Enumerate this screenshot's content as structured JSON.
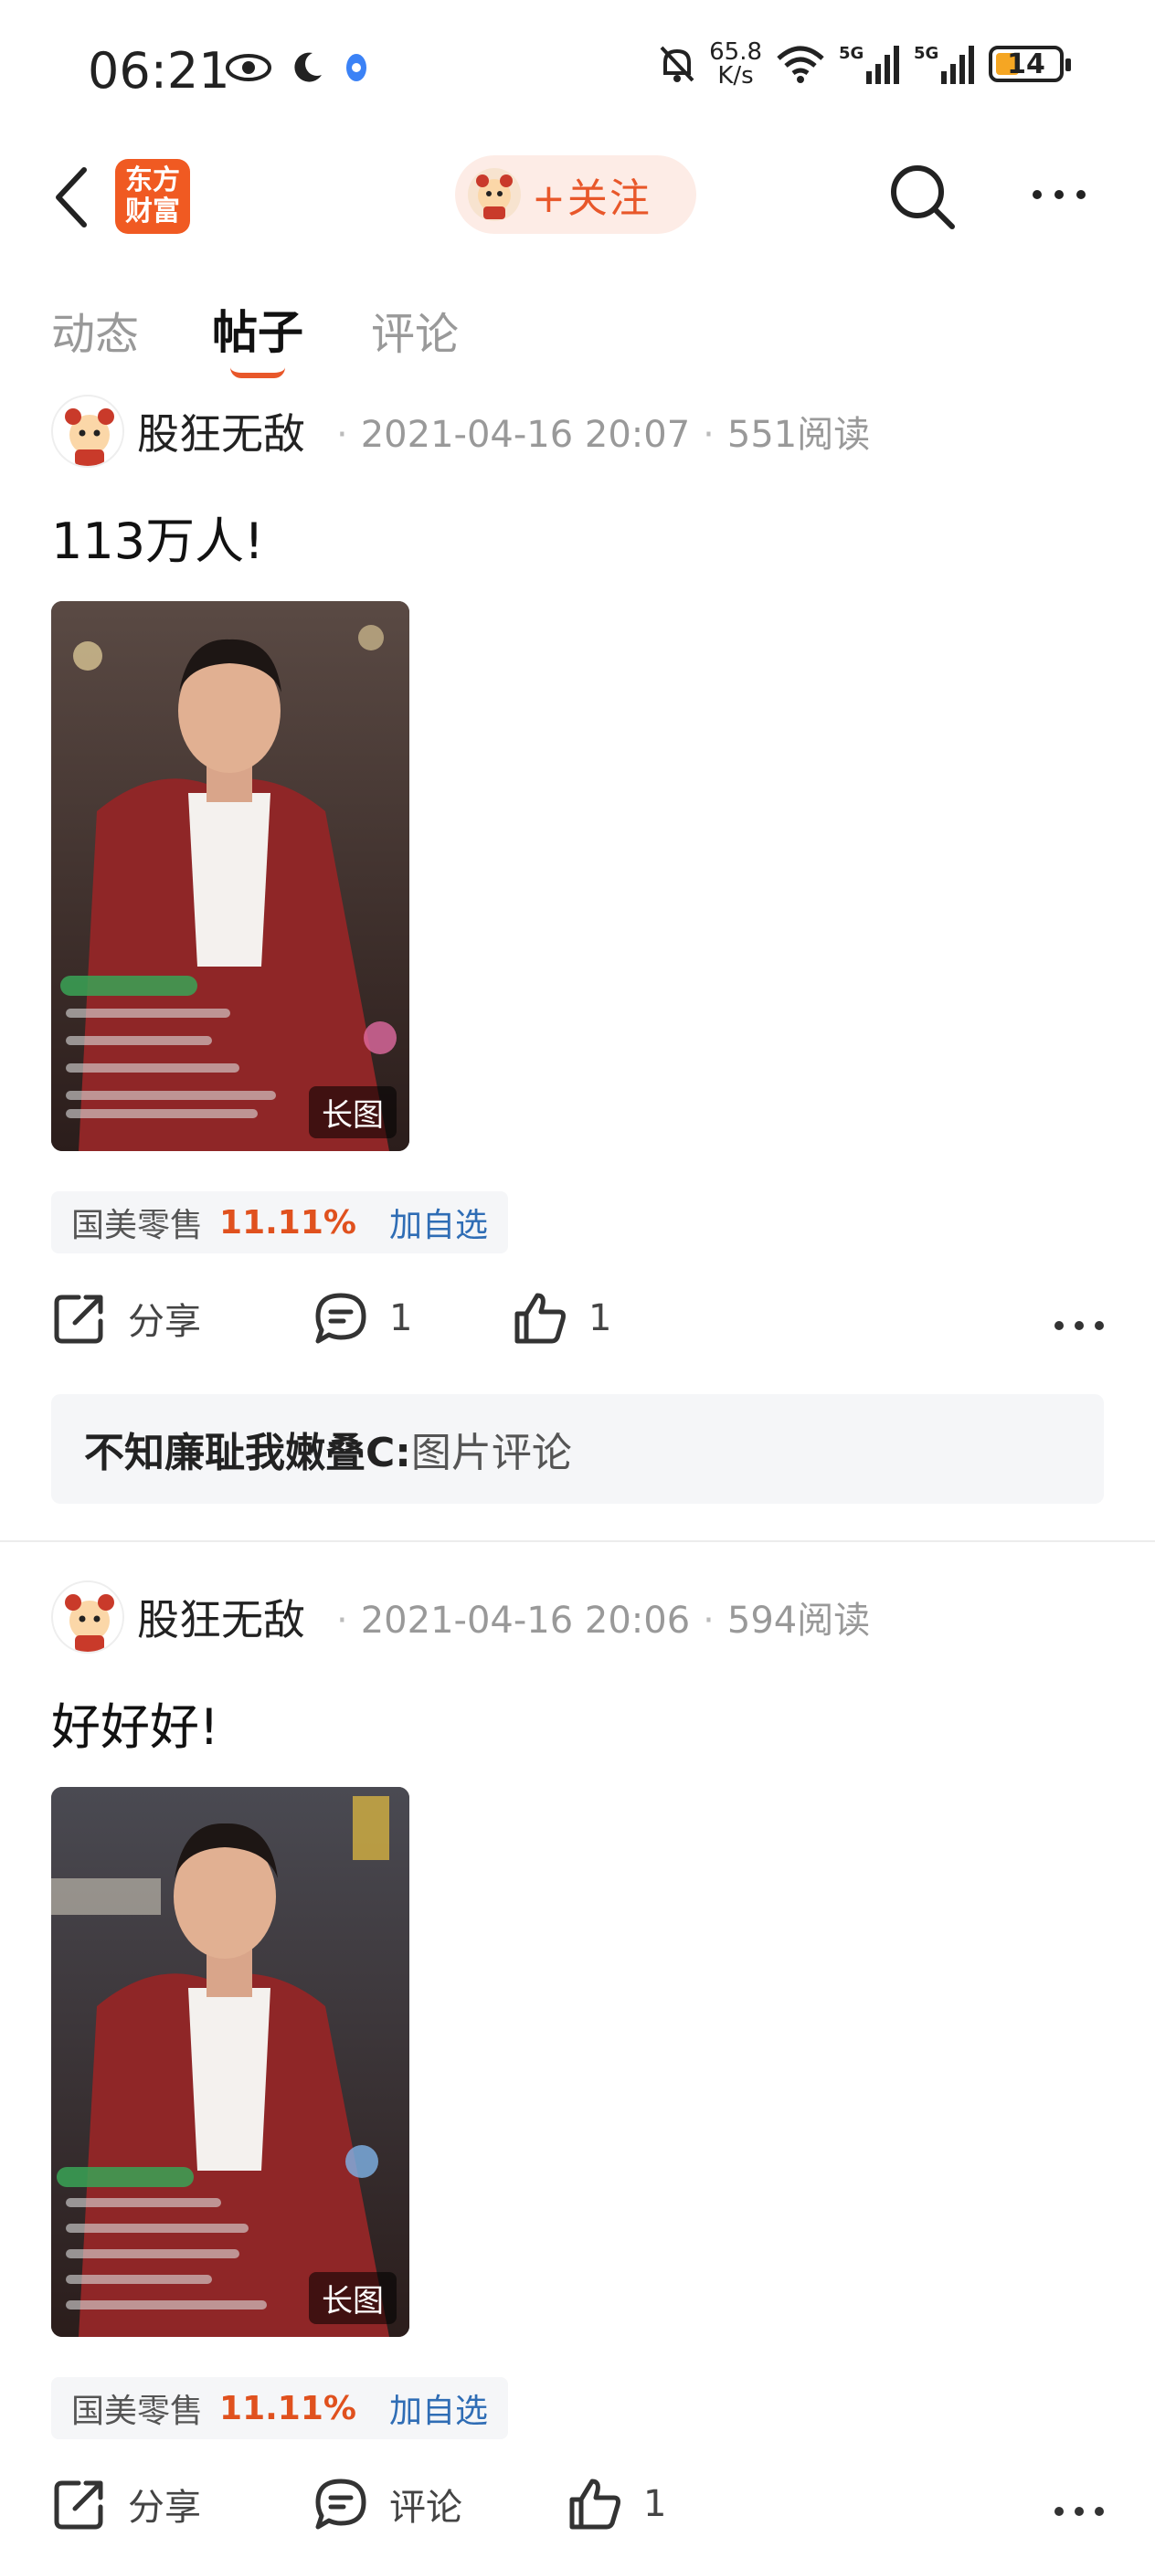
{
  "status_bar": {
    "time": "06:21",
    "net_speed_value": "65.8",
    "net_speed_unit": "K/s",
    "battery": "14",
    "icons": [
      "eye-icon",
      "moon-icon",
      "location-icon",
      "mute-icon",
      "wifi-icon",
      "signal-5g-icon",
      "signal-5g-icon",
      "battery-icon"
    ]
  },
  "header": {
    "logo_line1": "东方",
    "logo_line2": "财富",
    "follow_label": "+关注"
  },
  "tabs": [
    {
      "label": "动态",
      "active": false
    },
    {
      "label": "帖子",
      "active": true
    },
    {
      "label": "评论",
      "active": false
    }
  ],
  "posts": [
    {
      "author": "股狂无敌",
      "datetime": "2021-04-16 20:07",
      "reads": "551阅读",
      "text": "113万人!",
      "image_tag": "长图",
      "stock_name": "国美零售",
      "stock_pct": "11.11%",
      "stock_action": "加自选",
      "share_label": "分享",
      "comment_count": "1",
      "like_count": "1",
      "comment_user": "不知廉耻我嫩叠C:",
      "comment_text": "图片评论"
    },
    {
      "author": "股狂无敌",
      "datetime": "2021-04-16 20:06",
      "reads": "594阅读",
      "text": "好好好!",
      "image_tag": "长图",
      "stock_name": "国美零售",
      "stock_pct": "11.11%",
      "stock_action": "加自选",
      "share_label": "分享",
      "comment_label": "评论",
      "like_count": "1"
    }
  ],
  "colors": {
    "accent": "#e8572a",
    "brand": "#f05a22",
    "link": "#2f6db5"
  }
}
